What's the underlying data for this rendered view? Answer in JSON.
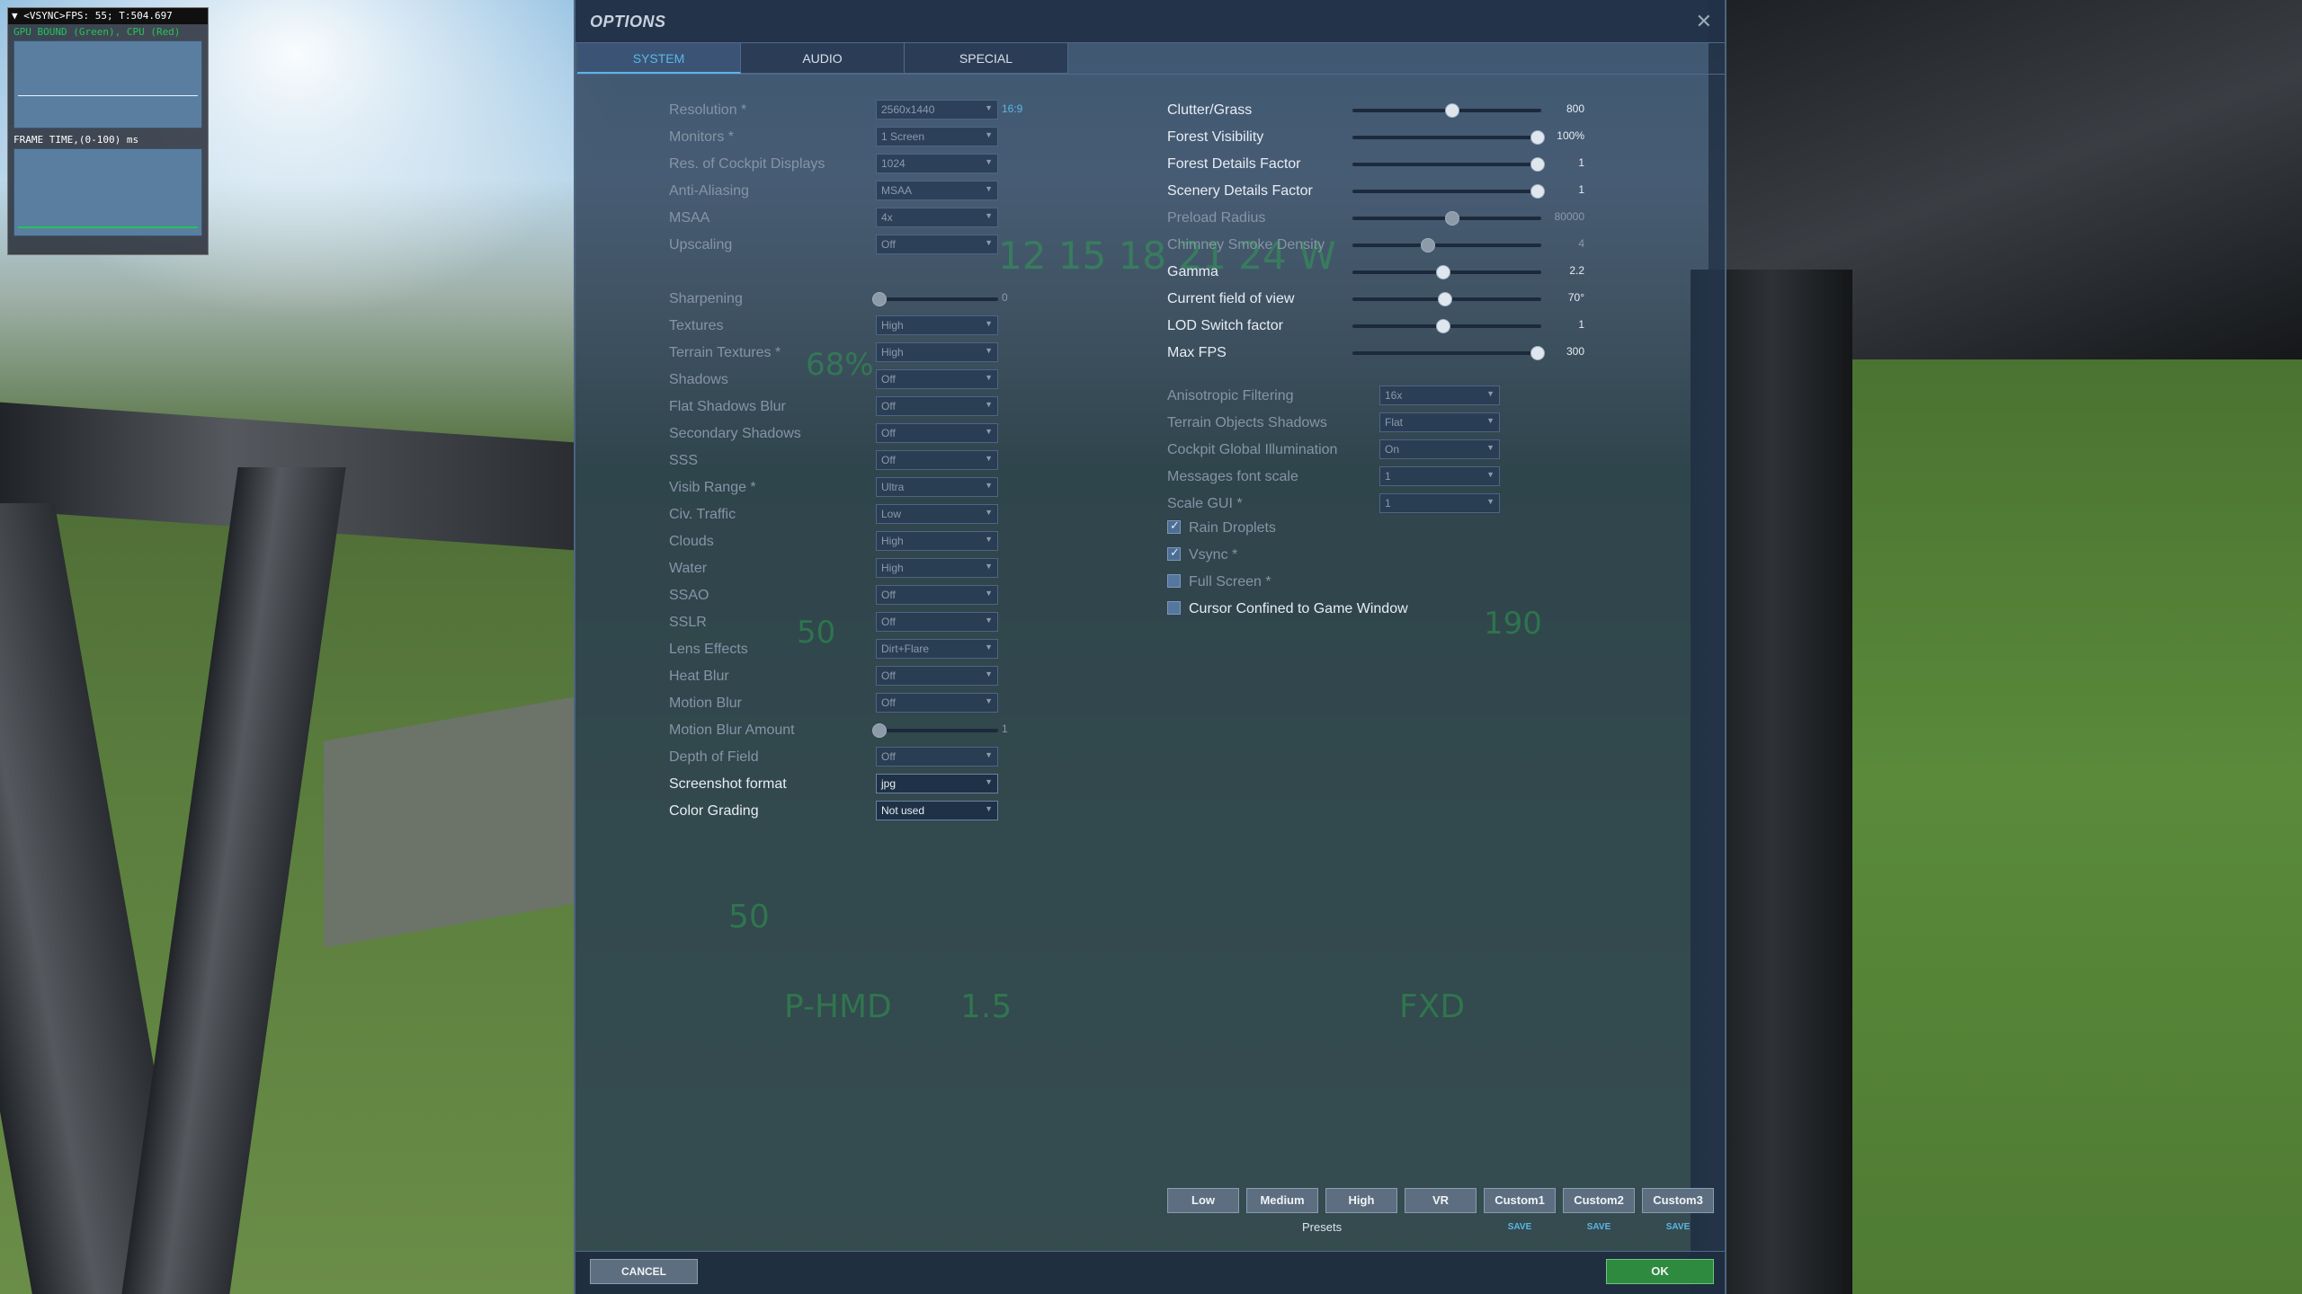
{
  "fps_overlay": {
    "header": "▼ <VSYNC>FPS: 55; T:504.697",
    "gpu_bound": "GPU BOUND (Green), CPU (Red)",
    "frame_time_label": "FRAME TIME,(0-100) ms"
  },
  "dialog": {
    "title": "OPTIONS",
    "close_icon": "close-icon",
    "tabs": [
      "SYSTEM",
      "AUDIO",
      "SPECIAL"
    ],
    "active_tab": "SYSTEM"
  },
  "left_settings": [
    {
      "label": "Resolution *",
      "value": "2560x1440",
      "note": "16:9",
      "enabled": false
    },
    {
      "label": "Monitors *",
      "value": "1 Screen",
      "enabled": false
    },
    {
      "label": "Res. of Cockpit Displays",
      "value": "1024",
      "enabled": false
    },
    {
      "label": "Anti-Aliasing",
      "value": "MSAA",
      "enabled": false
    },
    {
      "label": "MSAA",
      "value": "4x",
      "enabled": false
    },
    {
      "label": "Upscaling",
      "value": "Off",
      "enabled": false
    }
  ],
  "sharpening": {
    "label": "Sharpening",
    "value": "0",
    "fraction": 0.0
  },
  "left_settings_2": [
    {
      "label": "Textures",
      "value": "High",
      "enabled": false
    },
    {
      "label": "Terrain Textures *",
      "value": "High",
      "enabled": false
    },
    {
      "label": "Shadows",
      "value": "Off",
      "enabled": false
    },
    {
      "label": "Flat Shadows Blur",
      "value": "Off",
      "enabled": false
    },
    {
      "label": "Secondary Shadows",
      "value": "Off",
      "enabled": false
    },
    {
      "label": "SSS",
      "value": "Off",
      "enabled": false
    },
    {
      "label": "Visib Range *",
      "value": "Ultra",
      "enabled": false
    },
    {
      "label": "Civ. Traffic",
      "value": "Low",
      "enabled": false
    },
    {
      "label": "Clouds",
      "value": "High",
      "enabled": false
    },
    {
      "label": "Water",
      "value": "High",
      "enabled": false
    },
    {
      "label": "SSAO",
      "value": "Off",
      "enabled": false
    },
    {
      "label": "SSLR",
      "value": "Off",
      "enabled": false
    },
    {
      "label": "Lens Effects",
      "value": "Dirt+Flare",
      "enabled": false
    },
    {
      "label": "Heat Blur",
      "value": "Off",
      "enabled": false
    },
    {
      "label": "Motion Blur",
      "value": "Off",
      "enabled": false
    }
  ],
  "motion_blur_amount": {
    "label": "Motion Blur Amount",
    "value": "1",
    "fraction": 0.0
  },
  "left_settings_3": [
    {
      "label": "Depth of Field",
      "value": "Off",
      "enabled": false
    },
    {
      "label": "Screenshot format",
      "value": "jpg",
      "enabled": true
    },
    {
      "label": "Color Grading",
      "value": "Not used",
      "enabled": true
    }
  ],
  "right_sliders": [
    {
      "label": "Clutter/Grass",
      "value": "800",
      "fraction": 0.53,
      "enabled": true
    },
    {
      "label": "Forest Visibility",
      "value": "100%",
      "fraction": 0.98,
      "enabled": true
    },
    {
      "label": "Forest Details Factor",
      "value": "1",
      "fraction": 0.98,
      "enabled": true
    },
    {
      "label": "Scenery Details Factor",
      "value": "1",
      "fraction": 0.98,
      "enabled": true
    },
    {
      "label": "Preload Radius",
      "value": "80000",
      "fraction": 0.53,
      "enabled": false
    },
    {
      "label": "Chimney Smoke Density",
      "value": "4",
      "fraction": 0.4,
      "enabled": false
    },
    {
      "label": "Gamma",
      "value": "2.2",
      "fraction": 0.48,
      "enabled": true
    },
    {
      "label": "Current field of view",
      "value": "70°",
      "fraction": 0.49,
      "enabled": true
    },
    {
      "label": "LOD Switch factor",
      "value": "1",
      "fraction": 0.48,
      "enabled": true
    },
    {
      "label": "Max FPS",
      "value": "300",
      "fraction": 0.98,
      "enabled": true
    }
  ],
  "right_selects": [
    {
      "label": "Anisotropic Filtering",
      "value": "16x",
      "enabled": false
    },
    {
      "label": "Terrain Objects Shadows",
      "value": "Flat",
      "enabled": false
    },
    {
      "label": "Cockpit Global Illumination",
      "value": "On",
      "enabled": false
    },
    {
      "label": "Messages font scale",
      "value": "1",
      "enabled": false
    },
    {
      "label": "Scale GUI *",
      "value": "1",
      "enabled": false
    }
  ],
  "checkboxes": [
    {
      "label": "Rain Droplets",
      "checked": true,
      "enabled": false
    },
    {
      "label": "Vsync *",
      "checked": true,
      "enabled": false
    },
    {
      "label": "Full Screen *",
      "checked": false,
      "enabled": false
    },
    {
      "label": "Cursor Confined to Game Window",
      "checked": false,
      "enabled": true
    }
  ],
  "presets": {
    "buttons": [
      "Low",
      "Medium",
      "High",
      "VR",
      "Custom1",
      "Custom2",
      "Custom3"
    ],
    "save_label": "SAVE",
    "label": "Presets"
  },
  "footer": {
    "cancel": "CANCEL",
    "ok": "OK"
  },
  "hud_text": [
    "12",
    "15",
    "18",
    "21",
    "24",
    "W",
    "68%",
    "50",
    "50",
    "190",
    "P-HMD",
    "1.5",
    "FXD"
  ]
}
